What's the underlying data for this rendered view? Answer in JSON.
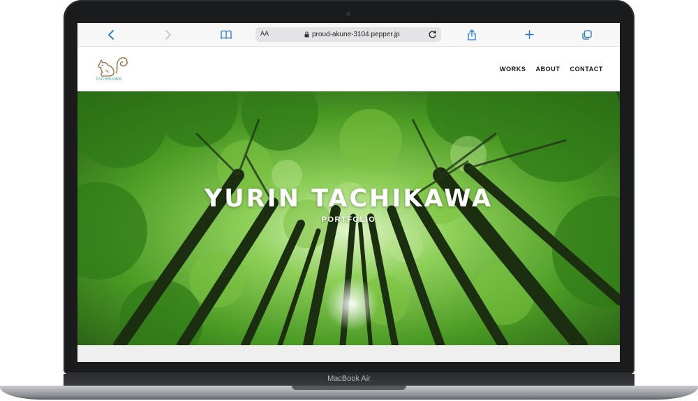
{
  "browser": {
    "text_size_label": "AA",
    "url": "proud-akune-3104.pepper.jp"
  },
  "site": {
    "logo_text": "TACHIKAWA",
    "nav": [
      "WORKS",
      "ABOUT",
      "CONTACT"
    ],
    "hero_title": "YURIN TACHIKAWA",
    "hero_subtitle": "PORTFOLIO"
  },
  "device": {
    "label": "MacBook Air"
  },
  "colors": {
    "accent": "#1a73e8",
    "logo_teal": "#3aa88c",
    "forest_green": "#3f8f1f"
  }
}
